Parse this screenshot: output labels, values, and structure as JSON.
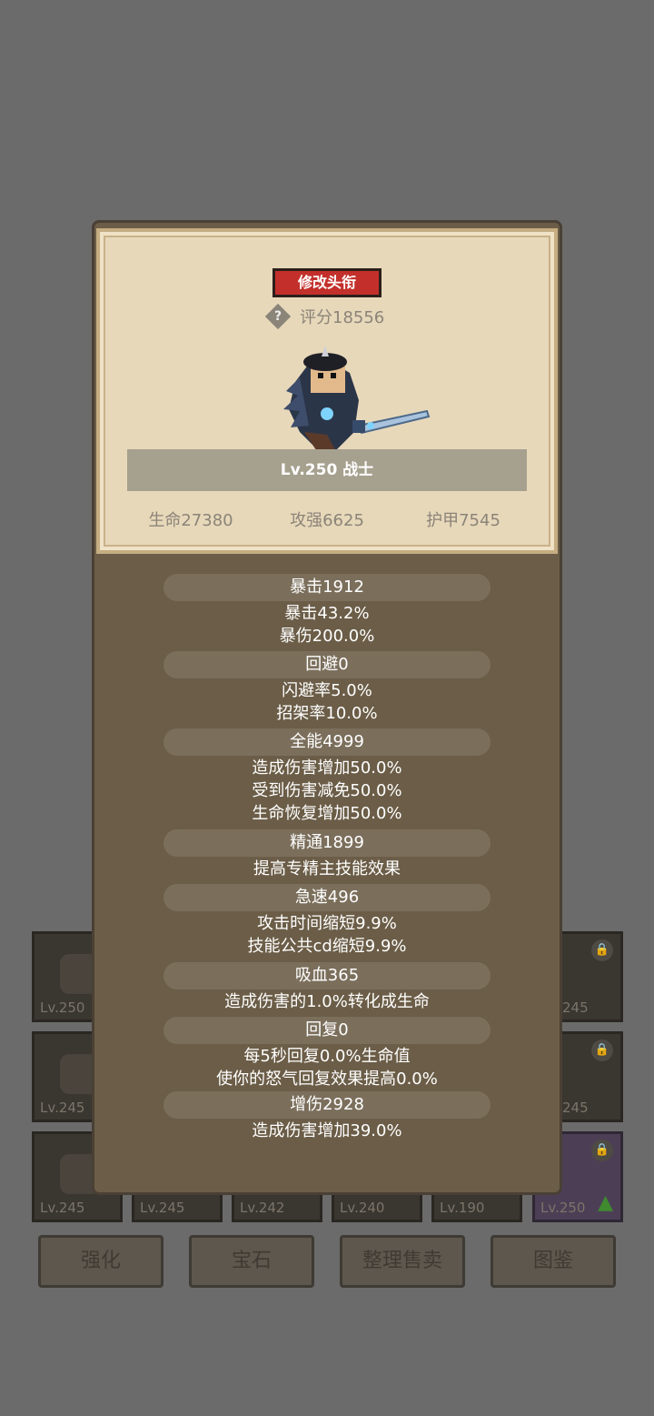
{
  "background": {
    "slots": [
      {
        "lv": "Lv.250"
      },
      {
        "lv": "245"
      },
      {
        "lv": "Lv.245"
      },
      {
        "lv": "245"
      },
      {
        "lv": "Lv.245"
      },
      {
        "lv": "Lv.245"
      },
      {
        "lv": "Lv.242"
      },
      {
        "lv": "Lv.240"
      },
      {
        "lv": "Lv.190"
      },
      {
        "lv": "Lv.250"
      }
    ],
    "buttons": [
      "强化",
      "宝石",
      "整理售卖",
      "图鉴"
    ]
  },
  "profile": {
    "change_title_label": "修改头衔",
    "score_help_glyph": "?",
    "score_text": "评分18556",
    "name_level": "Lv.250 战士",
    "stats": {
      "hp": "生命27380",
      "attack": "攻强6625",
      "armor": "护甲7545"
    }
  },
  "attributes": [
    {
      "header": "暴击1912",
      "lines": [
        "暴击43.2%",
        "暴伤200.0%"
      ]
    },
    {
      "header": "回避0",
      "lines": [
        "闪避率5.0%",
        "招架率10.0%"
      ]
    },
    {
      "header": "全能4999",
      "lines": [
        "造成伤害增加50.0%",
        "受到伤害减免50.0%",
        "生命恢复增加50.0%"
      ]
    },
    {
      "header": "精通1899",
      "lines": [
        "提高专精主技能效果"
      ]
    },
    {
      "header": "急速496",
      "lines": [
        "攻击时间缩短9.9%",
        "技能公共cd缩短9.9%"
      ]
    },
    {
      "header": "吸血365",
      "lines": [
        "造成伤害的1.0%转化成生命"
      ]
    },
    {
      "header": "回复0",
      "lines": [
        "每5秒回复0.0%生命值",
        "使你的怒气回复效果提高0.0%"
      ]
    },
    {
      "header": "增伤2928",
      "lines": [
        "造成伤害增加39.0%"
      ]
    }
  ]
}
